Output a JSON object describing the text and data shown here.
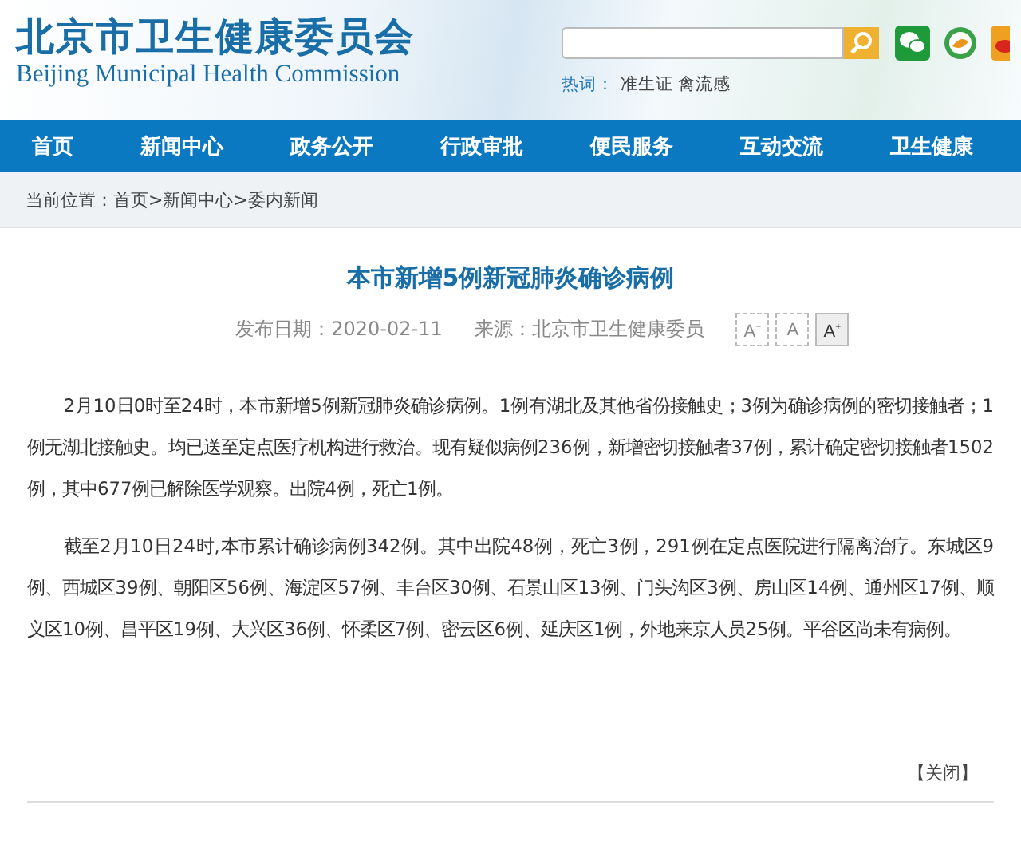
{
  "header": {
    "title": "北京市卫生健康委员会",
    "subtitle": "Beijing Municipal Health Commission",
    "hot_label": "热词：",
    "hot_words": [
      "准生证",
      "禽流感"
    ]
  },
  "nav": [
    {
      "label": "首页"
    },
    {
      "label": "新闻中心"
    },
    {
      "label": "政务公开"
    },
    {
      "label": "行政审批"
    },
    {
      "label": "便民服务"
    },
    {
      "label": "互动交流"
    },
    {
      "label": "卫生健康"
    }
  ],
  "breadcrumb": {
    "label": "当前位置：",
    "path": "首页>新闻中心>委内新闻"
  },
  "article": {
    "title": "本市新增5例新冠肺炎确诊病例",
    "date": "发布日期：2020-02-11",
    "source": "来源：北京市卫生健康委员",
    "font_buttons": [
      {
        "label": "A⁻",
        "selected": false
      },
      {
        "label": "A",
        "selected": false
      },
      {
        "label": "A⁺",
        "selected": true
      }
    ],
    "paragraphs": [
      "2月10日0时至24时，本市新增5例新冠肺炎确诊病例。1例有湖北及其他省份接触史；3例为确诊病例的密切接触者；1例无湖北接触史。均已送至定点医疗机构进行救治。现有疑似病例236例，新增密切接触者37例，累计确定密切接触者1502例，其中677例已解除医学观察。出院4例，死亡1例。",
      "截至2月10日24时,本市累计确诊病例342例。其中出院48例，死亡3例，291例在定点医院进行隔离治疗。东城区9例、西城区39例、朝阳区56例、海淀区57例、丰台区30例、石景山区13例、门头沟区3例、房山区14例、通州区17例、顺义区10例、昌平区19例、大兴区36例、怀柔区7例、密云区6例、延庆区1例，外地来京人员25例。平谷区尚未有病例。"
    ],
    "close": "【关闭】"
  }
}
